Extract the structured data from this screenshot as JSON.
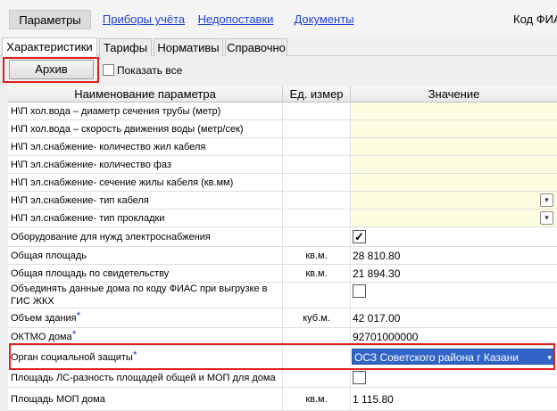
{
  "top_tabs": [
    {
      "label": "Параметры"
    },
    {
      "label": "Приборы учёта"
    },
    {
      "label": "Недопоставки"
    },
    {
      "label": "Документы"
    }
  ],
  "fias_label": "Код ФИА",
  "sub_tabs": [
    {
      "label": "Характеристики"
    },
    {
      "label": "Тарифы"
    },
    {
      "label": "Нормативы"
    },
    {
      "label": "Справочно"
    }
  ],
  "toolbar": {
    "archive_label": "Архив",
    "show_all_label": "Показать все"
  },
  "columns": {
    "name": "Наименование параметра",
    "unit": "Ед. измер",
    "value": "Значение"
  },
  "rows": [
    {
      "name": "Н\\П хол.вода – диаметр сечения трубы (метр)",
      "unit": "",
      "value": ""
    },
    {
      "name": "Н\\П хол.вода – скорость движения воды (метр/сек)",
      "unit": "",
      "value": ""
    },
    {
      "name": "Н\\П эл.снабжение- количество жил кабеля",
      "unit": "",
      "value": ""
    },
    {
      "name": "Н\\П эл.снабжение- количество фаз",
      "unit": "",
      "value": ""
    },
    {
      "name": "Н\\П эл.снабжение- сечение жилы кабеля (кв.мм)",
      "unit": "",
      "value": ""
    },
    {
      "name": "Н\\П эл.снабжение- тип кабеля",
      "unit": "",
      "value": ""
    },
    {
      "name": "Н\\П эл.снабжение- тип прокладки",
      "unit": "",
      "value": ""
    },
    {
      "name": "Оборудование для нужд электроснабжения",
      "unit": "",
      "value": ""
    },
    {
      "name": "Общая площадь",
      "unit": "кв.м.",
      "value": "28 810.80"
    },
    {
      "name": "Общая площадь по свидетельству",
      "unit": "кв.м.",
      "value": "21 894.30"
    },
    {
      "name": "Объединять данные дома по коду ФИАС при выгрузке в ГИС ЖКХ",
      "unit": "",
      "value": ""
    },
    {
      "name": "Объем здания",
      "unit": "куб.м.",
      "value": "42 017.00"
    },
    {
      "name": "ОКТМО дома",
      "unit": "",
      "value": "92701000000"
    },
    {
      "name": "Орган социальной защиты",
      "unit": "",
      "value": "ОСЗ Советского района г Казани"
    },
    {
      "name": "Площадь ЛС-разность площадей общей и МОП для дома",
      "unit": "",
      "value": ""
    },
    {
      "name": "Площадь МОП дома",
      "unit": "кв.м.",
      "value": "1 115.80"
    }
  ],
  "required_mark": "*",
  "checkbox_mark": "✓",
  "dropdown_glyph": "▾",
  "colors": {
    "highlight": "#e02020",
    "link": "#1f43d6",
    "value_bg": "#fffde1",
    "selected": "#3264c8"
  }
}
